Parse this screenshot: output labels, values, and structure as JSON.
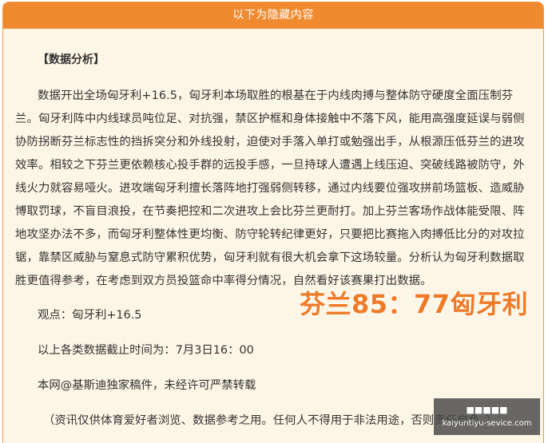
{
  "header": {
    "title": "以下为隐藏内容"
  },
  "article": {
    "section_title": "【数据分析】",
    "paragraph": "数据开出全场匈牙利+16.5，匈牙利本场取胜的根基在于内线肉搏与整体防守硬度全面压制芬兰。匈牙利阵中内线球员吨位足、对抗强，禁区护框和身体接触中不落下风，能用高强度延误与弱侧协防拐断芬兰标志性的挡拆突分和外线投射，迫使对手落入单打或勉强出手，从根源压低芬兰的进攻效率。相较之下芬兰更依赖核心投手群的远投手感，一旦持球人遭遇上线压迫、突破线路被防守，外线火力就容易哑火。进攻端匈牙利擅长落阵地打强弱侧转移，通过内线要位强攻拼前场篮板、造威胁博取罚球，不盲目浪投，在节奏把控和二次进攻上会比芬兰更耐打。加上芬兰客场作战体能受限、阵地攻坚办法不多，而匈牙利整体性更均衡、防守轮转纪律更好，只要把比赛拖入肉搏低比分的对攻拉锯，靠禁区威胁与窒息式防守累积优势，匈牙利就有很大机会拿下这场较量。分析认为匈牙利数据取胜更值得参考，在考虑到双方员投篮命中率得分情况，自然看好该赛果打出数据。",
    "viewpoint": "观点：匈牙利+16.5",
    "cutoff": "以上各类数据截止时间为：7月3日16：00",
    "copyright": "本网@基斯迪独家稿件，未经许可严禁转载",
    "disclaimer": "（资讯仅供体育爱好者浏览、数据参考之用。任何人不得用于非法用途，否则责任自负。）"
  },
  "score_overlay": {
    "text": "芬兰85：77匈牙利",
    "color": "#f07a26"
  },
  "watermark": {
    "line1": "■■■■■",
    "url": "kaiyuntiyu-sevice.com"
  },
  "colors": {
    "header_bg": "#f08a2f",
    "panel_bg": "#fdf6e6",
    "border": "#ef9a4a"
  }
}
